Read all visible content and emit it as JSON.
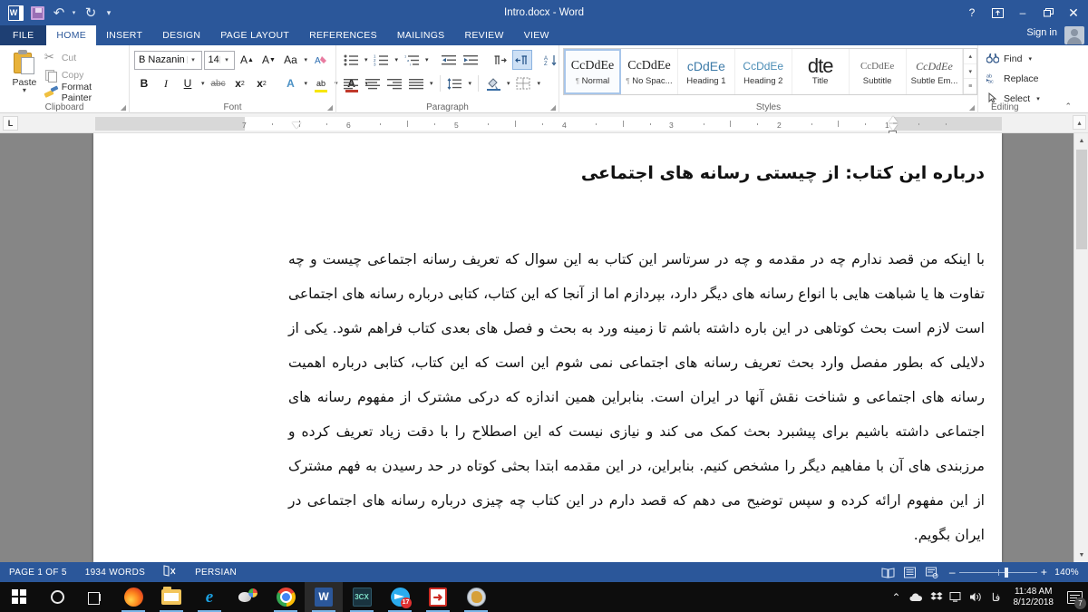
{
  "titlebar": {
    "document_title": "Intro.docx - Word",
    "quick_access": [
      {
        "name": "word-logo",
        "label": ""
      },
      {
        "name": "save-icon",
        "label": ""
      },
      {
        "name": "undo-icon",
        "label": "↶"
      },
      {
        "name": "redo-icon",
        "label": "↻"
      },
      {
        "name": "customize-qat-icon",
        "label": "▾"
      }
    ],
    "help_label": "?",
    "ribbon_display_label": "⬜",
    "minimize_label": "–",
    "restore_label": "❐",
    "close_label": "✕",
    "signin_label": "Sign in"
  },
  "tabs": [
    {
      "label": "FILE",
      "active": false
    },
    {
      "label": "HOME",
      "active": true
    },
    {
      "label": "INSERT",
      "active": false
    },
    {
      "label": "DESIGN",
      "active": false
    },
    {
      "label": "PAGE LAYOUT",
      "active": false
    },
    {
      "label": "REFERENCES",
      "active": false
    },
    {
      "label": "MAILINGS",
      "active": false
    },
    {
      "label": "REVIEW",
      "active": false
    },
    {
      "label": "VIEW",
      "active": false
    }
  ],
  "ribbon": {
    "clipboard": {
      "group_label": "Clipboard",
      "paste_label": "Paste",
      "cut_label": "Cut",
      "copy_label": "Copy",
      "format_painter_label": "Format Painter"
    },
    "font": {
      "group_label": "Font",
      "font_name": "B Nazanin",
      "font_size": "14",
      "grow_font_label": "A",
      "shrink_font_label": "A",
      "change_case_label": "Aa",
      "clear_formatting_label": "✐",
      "bold_label": "B",
      "italic_label": "I",
      "underline_label": "U",
      "strikethrough_label": "abc",
      "subscript_label": "x",
      "superscript_label": "x",
      "text_effects_label": "A",
      "highlight_label": "ab",
      "font_color_label": "A",
      "font_color_hex": "#c0392b",
      "highlight_color_hex": "#f7e600"
    },
    "paragraph": {
      "group_label": "Paragraph",
      "bullets_label": "≡",
      "numbering_label": "≡",
      "multilevel_label": "≡",
      "decrease_indent_label": "⇤",
      "increase_indent_label": "⇥",
      "ltr_label": "¶",
      "rtl_label": "¶",
      "rtl_active": true,
      "sort_label": "A↓",
      "show_marks_label": "¶",
      "align_left_label": "≡",
      "align_center_label": "≡",
      "align_right_label": "≡",
      "justify_label": "≡",
      "line_spacing_label": "↕",
      "shading_label": "■",
      "borders_label": "⊞"
    },
    "styles": {
      "group_label": "Styles",
      "items": [
        {
          "preview": "CcDdEe",
          "name": "Normal",
          "pilcrow": "¶",
          "selected": true
        },
        {
          "preview": "CcDdEe",
          "name": "No Spac...",
          "pilcrow": "¶",
          "selected": false
        },
        {
          "preview": "cDdEe",
          "name": "Heading 1",
          "pilcrow": "",
          "selected": false
        },
        {
          "preview": "CcDdEe",
          "name": "Heading 2",
          "pilcrow": "",
          "selected": false
        },
        {
          "preview": "dte",
          "name": "Title",
          "pilcrow": "",
          "selected": false
        },
        {
          "preview": "CcDdEe",
          "name": "Subtitle",
          "pilcrow": "",
          "selected": false
        },
        {
          "preview": "CcDdEe",
          "name": "Subtle Em...",
          "pilcrow": "",
          "selected": false
        }
      ],
      "scroll_up_label": "▴",
      "scroll_down_label": "▾",
      "more_label": "≡"
    },
    "editing": {
      "group_label": "Editing",
      "find_label": "Find",
      "replace_label": "Replace",
      "select_label": "Select",
      "find_icon": "🔍",
      "replace_icon": "ab",
      "select_icon": "↖"
    },
    "collapse_ribbon_label": "⌃"
  },
  "ruler": {
    "tab_selector_label": "L",
    "marks": [
      "7",
      "6",
      "5",
      "4",
      "3",
      "2",
      "1"
    ],
    "vertical_scroll_label": "▴"
  },
  "document": {
    "heading": "درباره این کتاب: از چیستی رسانه های اجتماعی",
    "body": "با اینکه من قصد ندارم چه در مقدمه و چه در سرتاسر این کتاب به این سوال که تعریف رسانه اجتماعی چیست و چه تفاوت ها یا شباهت هایی با انواع رسانه های دیگر دارد، بپردازم اما از آنجا که این کتاب، کتابی درباره رسانه های اجتماعی است لازم است بحث کوتاهی در این باره داشته باشم تا زمینه ورد به بحث و فصل های بعدی کتاب فراهم شود. یکی از دلایلی که بطور مفصل وارد بحث تعریف رسانه های اجتماعی نمی شوم این است که این کتاب، کتابی درباره اهمیت رسانه های اجتماعی و شناخت نقش آنها  در ایران است. بنابراین همین اندازه که درکی مشترک از مفهوم رسانه های اجتماعی داشته باشیم برای پیشبرد بحث کمک می کند و نیازی نیست که این اصطلاح را با دقت زیاد تعریف کرده و مرزبندی های آن با مفاهیم دیگر را مشخص کنیم. بنابراین، در این مقدمه ابتدا بحثی کوتاه در حد رسیدن به فهم مشترک از این مفهوم ارائه کرده و سپس توضیح می دهم که قصد دارم در این کتاب چه چیزی درباره رسانه های اجتماعی در ایران بگویم."
  },
  "statusbar": {
    "page_label": "PAGE 1 OF 5",
    "words_label": "1934 WORDS",
    "proofing_icon": "☐",
    "language_label": "PERSIAN",
    "view_read_label": "◫",
    "view_print_label": "▤",
    "view_web_label": "▦",
    "zoom_out_label": "–",
    "zoom_in_label": "+",
    "zoom_level": "140%"
  },
  "taskbar": {
    "items": [
      {
        "name": "start-button",
        "icon": "windows-logo-icon",
        "label": "",
        "running": false,
        "active": false
      },
      {
        "name": "cortana-button",
        "icon": "cortana-circle-icon",
        "label": "",
        "running": false,
        "active": false
      },
      {
        "name": "task-view-button",
        "icon": "task-view-icon",
        "label": "",
        "running": false,
        "active": false
      },
      {
        "name": "taskbar-firefox",
        "icon": "firefox-icon",
        "label": "",
        "running": true,
        "active": false
      },
      {
        "name": "taskbar-file-explorer",
        "icon": "folder-icon",
        "label": "",
        "running": true,
        "active": false
      },
      {
        "name": "taskbar-internet-explorer",
        "icon": "internet-explorer-icon",
        "label": "e",
        "running": true,
        "active": false
      },
      {
        "name": "taskbar-paint",
        "icon": "paint-icon",
        "label": "",
        "running": false,
        "active": false
      },
      {
        "name": "taskbar-chrome",
        "icon": "chrome-icon",
        "label": "",
        "running": true,
        "active": false
      },
      {
        "name": "taskbar-word",
        "icon": "word-icon",
        "label": "W",
        "running": true,
        "active": true
      },
      {
        "name": "taskbar-3cx",
        "icon": "3cx-icon",
        "label": "3CX",
        "running": true,
        "active": false
      },
      {
        "name": "taskbar-telegram",
        "icon": "telegram-icon",
        "label": "",
        "badge": "17",
        "running": true,
        "active": false
      },
      {
        "name": "taskbar-acrobat",
        "icon": "pdf-icon",
        "label": "A",
        "running": true,
        "active": false
      },
      {
        "name": "taskbar-globe-app",
        "icon": "globe-icon",
        "label": "",
        "running": true,
        "active": false
      }
    ],
    "tray": {
      "show_hidden_label": "⌃",
      "onedrive_label": "☁",
      "dropbox_label": "❖",
      "network_label": "🖥",
      "volume_label": "🔊",
      "language_label": "فا",
      "time": "11:48 AM",
      "date": "8/12/2018",
      "notification_count": "7"
    }
  }
}
